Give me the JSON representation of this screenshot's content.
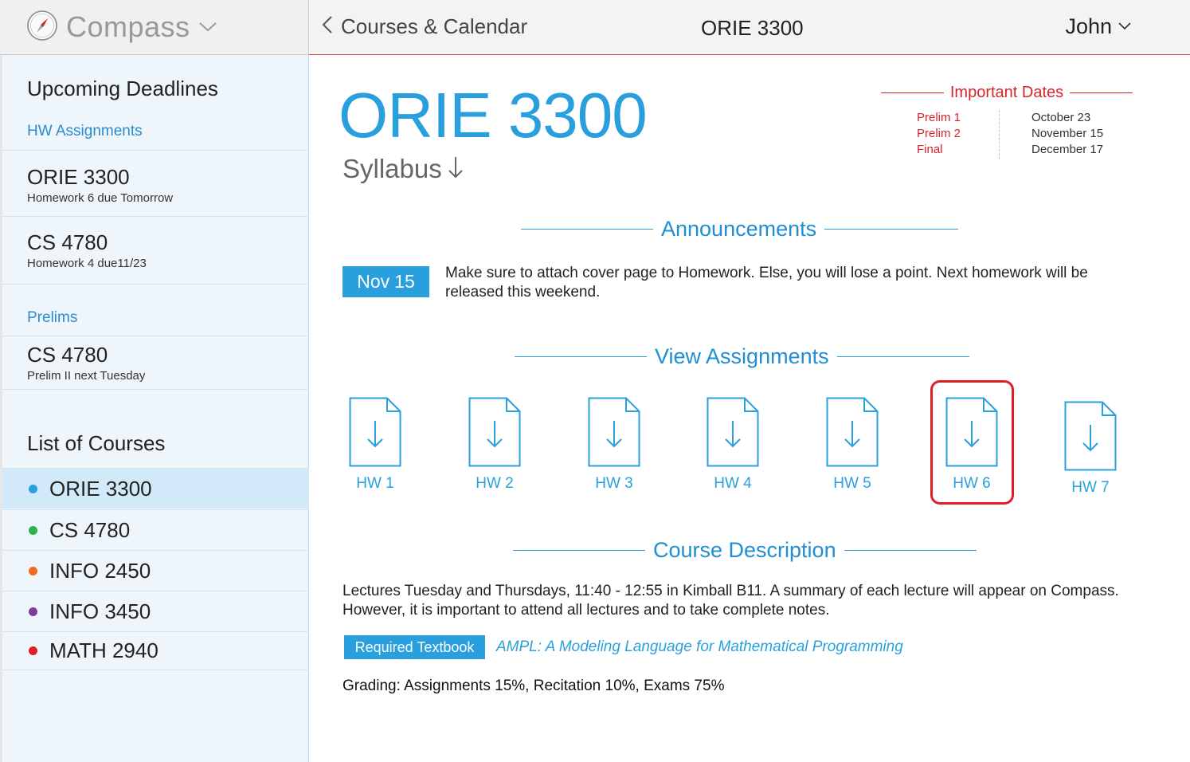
{
  "app": {
    "brand": "Compass"
  },
  "navbar": {
    "back_label": "Courses & Calendar",
    "title": "ORIE 3300",
    "user": "John"
  },
  "sidebar": {
    "upcoming_heading": "Upcoming Deadlines",
    "hw_heading": "HW Assignments",
    "hw_items": [
      {
        "title": "ORIE 3300",
        "subtitle": "Homework 6 due Tomorrow"
      },
      {
        "title": "CS 4780",
        "subtitle": "Homework 4 due11/23"
      }
    ],
    "prelims_heading": "Prelims",
    "prelim_items": [
      {
        "title": "CS 4780",
        "subtitle": "Prelim II next Tuesday"
      }
    ],
    "courses_heading": "List of Courses",
    "courses": [
      {
        "label": "ORIE 3300",
        "color": "#29a0dd",
        "active": true
      },
      {
        "label": "CS 4780",
        "color": "#2db34a",
        "active": false
      },
      {
        "label": "INFO 2450",
        "color": "#f26a22",
        "active": false
      },
      {
        "label": "INFO 3450",
        "color": "#7c3b9f",
        "active": false
      },
      {
        "label": "MATH 2940",
        "color": "#e01e26",
        "active": false
      }
    ]
  },
  "course": {
    "title": "ORIE 3300",
    "syllabus_label": "Syllabus",
    "important_dates": {
      "heading": "Important Dates",
      "items": [
        {
          "name": "Prelim 1",
          "date": "October 23"
        },
        {
          "name": "Prelim 2",
          "date": "November 15"
        },
        {
          "name": "Final",
          "date": "December 17"
        }
      ]
    },
    "announcements": {
      "heading": "Announcements",
      "month": "Nov",
      "day": "15",
      "text": "Make sure to attach cover page to Homework. Else, you will lose a point. Next homework will be released this weekend."
    },
    "assignments": {
      "heading": "View Assignments",
      "items": [
        "HW 1",
        "HW 2",
        "HW 3",
        "HW 4",
        "HW 5",
        "HW 6",
        "HW 7"
      ],
      "selected": "HW 6"
    },
    "description": {
      "heading": "Course Description",
      "text": "Lectures Tuesday and Thursdays, 11:40 - 12:55 in Kimball B11. A summary of each lecture will appear on Compass. However, it is important to attend all lectures and to take complete notes.",
      "textbook_badge": "Required Textbook",
      "textbook_title": "AMPL: A Modeling Language for Mathematical Programming",
      "grading": "Grading: Assignments 15%, Recitation 10%, Exams 75%"
    }
  },
  "colors": {
    "accent": "#29a0dd",
    "alert": "#e01e26",
    "sidebar_bg": "#eef6fc",
    "active_row": "#d2e9f9"
  },
  "icons": {
    "brand": "compass-icon",
    "back": "chevron-left-icon",
    "user_menu": "chevron-down-icon",
    "syllabus": "arrow-down-icon",
    "assignment": "file-download-icon"
  }
}
